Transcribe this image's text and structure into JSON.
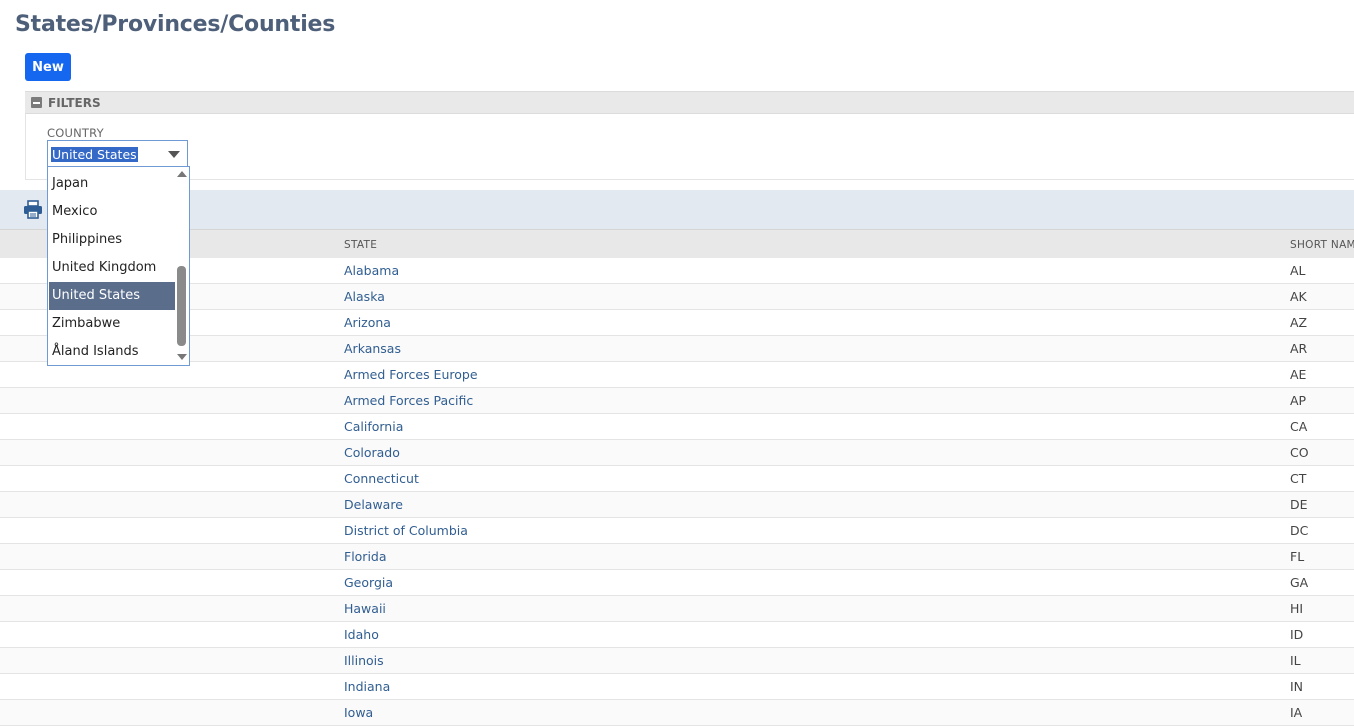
{
  "header": {
    "title": "States/Provinces/Counties",
    "new_label": "New"
  },
  "filters": {
    "title": "FILTERS",
    "country_label": "COUNTRY",
    "country_value": "United States",
    "dropdown_options": [
      "Japan",
      "Mexico",
      "Philippines",
      "United Kingdom",
      "United States",
      "Zimbabwe",
      "Åland Islands"
    ],
    "selected_option": "United States"
  },
  "toolbar": {
    "print_icon": "print-icon"
  },
  "table": {
    "columns": [
      "STATE",
      "SHORT NAM"
    ],
    "rows": [
      {
        "state": "Alabama",
        "short": "AL"
      },
      {
        "state": "Alaska",
        "short": "AK"
      },
      {
        "state": "Arizona",
        "short": "AZ"
      },
      {
        "state": "Arkansas",
        "short": "AR"
      },
      {
        "state": "Armed Forces Europe",
        "short": "AE"
      },
      {
        "state": "Armed Forces Pacific",
        "short": "AP"
      },
      {
        "state": "California",
        "short": "CA"
      },
      {
        "state": "Colorado",
        "short": "CO"
      },
      {
        "state": "Connecticut",
        "short": "CT"
      },
      {
        "state": "Delaware",
        "short": "DE"
      },
      {
        "state": "District of Columbia",
        "short": "DC"
      },
      {
        "state": "Florida",
        "short": "FL"
      },
      {
        "state": "Georgia",
        "short": "GA"
      },
      {
        "state": "Hawaii",
        "short": "HI"
      },
      {
        "state": "Idaho",
        "short": "ID"
      },
      {
        "state": "Illinois",
        "short": "IL"
      },
      {
        "state": "Indiana",
        "short": "IN"
      },
      {
        "state": "Iowa",
        "short": "IA"
      }
    ]
  },
  "colors": {
    "accent": "#1467ee",
    "link": "#315e91",
    "selected_option_bg": "#5a6e8c",
    "title": "#4d5f79"
  }
}
